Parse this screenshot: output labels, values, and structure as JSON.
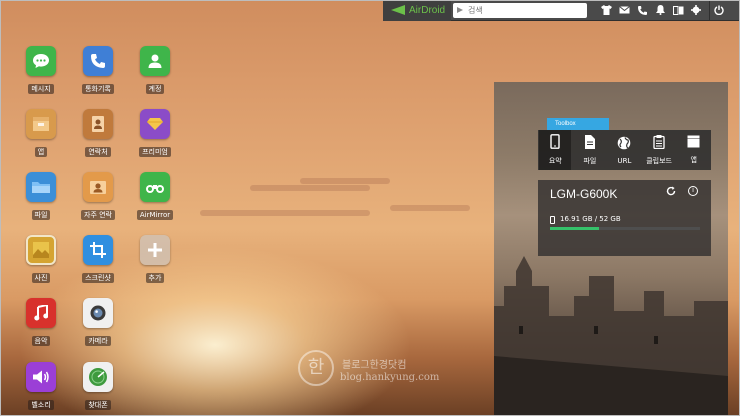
{
  "topbar": {
    "brand": "AirDroid",
    "search_placeholder": "검색",
    "icons": [
      "tshirt-icon",
      "mail-icon",
      "phone-icon",
      "bell-icon",
      "book-icon",
      "gear-icon",
      "power-icon"
    ],
    "brand_color": "#6cc04a"
  },
  "apps": [
    {
      "label": "메시지",
      "icon": "chat-icon",
      "color": "#3fb54a"
    },
    {
      "label": "통화기록",
      "icon": "phone-icon",
      "color": "#3f7fd6"
    },
    {
      "label": "계정",
      "icon": "person-icon",
      "color": "#3fb54a"
    },
    {
      "label": "앱",
      "icon": "package-icon",
      "color": "#d89a4c"
    },
    {
      "label": "연락처",
      "icon": "contacts-icon",
      "color": "#c07a3c"
    },
    {
      "label": "프리미엄",
      "icon": "diamond-icon",
      "color": "#8b4cc8"
    },
    {
      "label": "파일",
      "icon": "folder-icon",
      "color": "#3b8fd8"
    },
    {
      "label": "자주 연락",
      "icon": "frequent-contacts-icon",
      "color": "#e39a4a"
    },
    {
      "label": "AirMirror",
      "icon": "binoculars-icon",
      "color": "#3fb54a"
    },
    {
      "label": "사진",
      "icon": "photo-icon",
      "color": "#d5a431"
    },
    {
      "label": "스크린샷",
      "icon": "crop-icon",
      "color": "#2f8fe0"
    },
    {
      "label": "추가",
      "icon": "plus-icon",
      "color": "#c9c1b8"
    },
    {
      "label": "음악",
      "icon": "music-icon",
      "color": "#d8312c"
    },
    {
      "label": "카메라",
      "icon": "camera-icon",
      "color": "#f0f0f0"
    },
    {
      "label": "벨소리",
      "icon": "speaker-icon",
      "color": "#9b3fd6"
    },
    {
      "label": "찾대폰",
      "icon": "radar-icon",
      "color": "#3e9a3e"
    }
  ],
  "toolbox": {
    "title": "Toolbox",
    "tab_color": "#36a7e2",
    "items": [
      {
        "label": "요약",
        "icon": "phone-outline-icon"
      },
      {
        "label": "파일",
        "icon": "file-icon"
      },
      {
        "label": "URL",
        "icon": "globe-icon"
      },
      {
        "label": "클립보드",
        "icon": "clipboard-icon"
      },
      {
        "label": "앱",
        "icon": "app-box-icon"
      }
    ]
  },
  "device": {
    "name": "LGM-G600K",
    "storage": "16.91 GB / 52 GB",
    "storage_used_fraction": 0.325,
    "bar_color": "#35c26a"
  },
  "watermark": {
    "seal": "한",
    "line1": "블로그한경닷컴",
    "line2": "blog.hankyung.com"
  }
}
